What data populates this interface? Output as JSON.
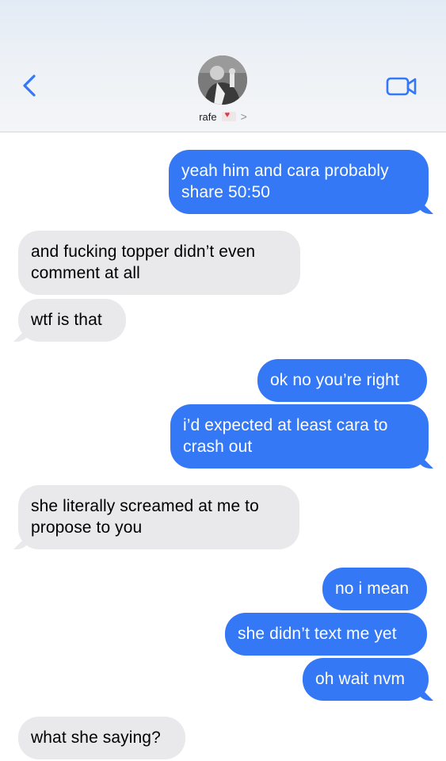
{
  "header": {
    "contact_name": "rafe",
    "chevron": ">",
    "back_icon": "chevron-left-icon",
    "video_icon": "video-camera-icon",
    "accent": "#3478f6"
  },
  "messages": [
    {
      "id": 1,
      "side": "outgoing",
      "text": "yeah him and cara probably\nshare 50:50"
    },
    {
      "id": 2,
      "side": "incoming",
      "text": "and fucking topper didn’t even\ncomment at all"
    },
    {
      "id": 3,
      "side": "incoming",
      "text": "wtf is that"
    },
    {
      "id": 4,
      "side": "outgoing",
      "text": "ok no you’re right"
    },
    {
      "id": 5,
      "side": "outgoing",
      "text": "i’d expected at least cara to\ncrash out"
    },
    {
      "id": 6,
      "side": "incoming",
      "text": "she literally screamed at me to\npropose to you"
    },
    {
      "id": 7,
      "side": "outgoing",
      "text": "no i mean"
    },
    {
      "id": 8,
      "side": "outgoing",
      "text": "she didn’t text me yet"
    },
    {
      "id": 9,
      "side": "outgoing",
      "text": "oh wait nvm"
    },
    {
      "id": 10,
      "side": "incoming",
      "text": "what she saying?"
    }
  ]
}
